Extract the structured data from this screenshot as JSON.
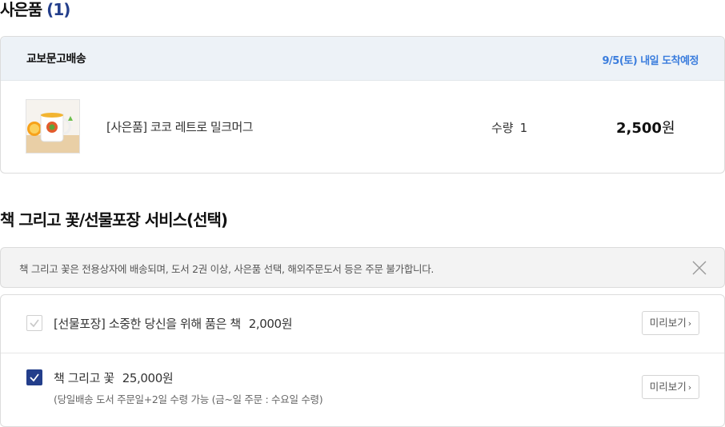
{
  "gift": {
    "title": "사은품",
    "count": "(1)"
  },
  "shipping": {
    "carrier": "교보문고배송",
    "arrival": "9/5(토) 내일 도착예정",
    "item": {
      "name": "[사은품] 코코 레트로 밀크머그",
      "qty_label": "수량",
      "qty": "1",
      "price": "2,500",
      "currency": "원"
    }
  },
  "services": {
    "title": "책 그리고 꽃/선물포장 서비스(선택)",
    "notice": "책 그리고 꽃은 전용상자에 배송되며, 도서 2권 이상, 사은품 선택, 해외주문도서 등은 주문 불가합니다.",
    "options": [
      {
        "label": "[선물포장] 소중한 당신을 위해 품은 책",
        "price": "2,000원",
        "checked": false,
        "preview": "미리보기"
      },
      {
        "label": "책 그리고 꽃",
        "price": "25,000원",
        "sub": "(당일배송 도서 주문일+2일 수령 가능 (금~일 주문 : 수요일 수령)",
        "checked": true,
        "preview": "미리보기"
      }
    ]
  },
  "colors": {
    "accent": "#233e8b",
    "date": "#3b7ddd",
    "header_bg": "#edf2f7"
  }
}
